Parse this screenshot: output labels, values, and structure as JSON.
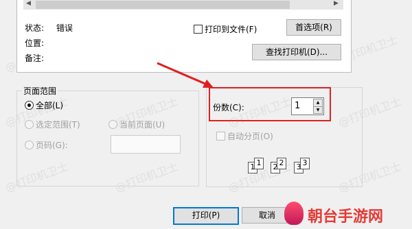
{
  "printer": {
    "status_label": "状态:",
    "status_value": "错误",
    "location_label": "位置:",
    "comment_label": "备注:",
    "print_to_file": "打印到文件(F)",
    "preferences_button": "首选项(R)",
    "find_printer_button": "查找打印机(D)..."
  },
  "page_range": {
    "legend": "页面范围",
    "all": "全部(L)",
    "selection": "选定范围(T)",
    "current_page": "当前页面(U)",
    "pages": "页码(G):"
  },
  "copies": {
    "label": "份数(C):",
    "value": "1",
    "collate": "自动分页(O)",
    "collate_pages": [
      "1",
      "1",
      "2",
      "2",
      "3",
      "3"
    ]
  },
  "footer": {
    "print_button": "打印(P)",
    "cancel_button": "取消"
  },
  "watermark_text": "@打印机卫士",
  "brand_text": "朝台手游网",
  "colors": {
    "highlight_red": "#e02020",
    "focus_blue": "#0078d7"
  }
}
